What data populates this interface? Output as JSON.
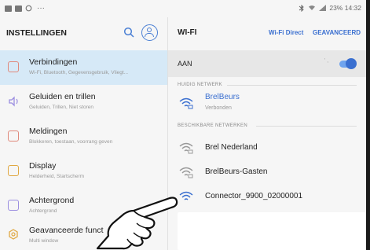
{
  "status_bar": {
    "right_text": "23% 14:32"
  },
  "left_panel": {
    "title": "INSTELLINGEN",
    "items": [
      {
        "title": "Verbindingen",
        "subtitle": "Wi-Fi, Bluetooth, Gegevensgebruik, Vliegt...",
        "active": true,
        "icon": "connections-icon",
        "color": "#e0897c"
      },
      {
        "title": "Geluiden en trillen",
        "subtitle": "Geluiden, Trillen, Niet storen",
        "active": false,
        "icon": "sound-icon",
        "color": "#9b8ee0"
      },
      {
        "title": "Meldingen",
        "subtitle": "Blokkeren, toestaan, voorrang geven",
        "active": false,
        "icon": "notifications-icon",
        "color": "#e0897c"
      },
      {
        "title": "Display",
        "subtitle": "Helderheid, Startscherm",
        "active": false,
        "icon": "display-icon",
        "color": "#e0a843"
      },
      {
        "title": "Achtergrond",
        "subtitle": "Achtergrond",
        "active": false,
        "icon": "wallpaper-icon",
        "color": "#9b8ee0"
      },
      {
        "title": "Geavanceerde funct",
        "subtitle": "Multi window",
        "active": false,
        "icon": "advanced-features-icon",
        "color": "#e0a843"
      }
    ]
  },
  "right_panel": {
    "title": "WI-FI",
    "wifi_direct": "Wi-Fi Direct",
    "advanced": "GEAVANCEERD",
    "toggle_label": "AAN",
    "toggle_on": true,
    "current_section": "HUIDIG NETWERK",
    "current_network": {
      "name": "BrelBeurs",
      "status": "Verbonden"
    },
    "available_section": "BESCHIKBARE NETWERKEN",
    "networks": [
      {
        "name": "Brel Nederland"
      },
      {
        "name": "BrelBeurs-Gasten"
      },
      {
        "name": "Connector_9900_02000001"
      }
    ]
  },
  "colors": {
    "accent": "#3a6fd0",
    "active_row": "#d6e9f7",
    "background": "#f6f6f6"
  }
}
